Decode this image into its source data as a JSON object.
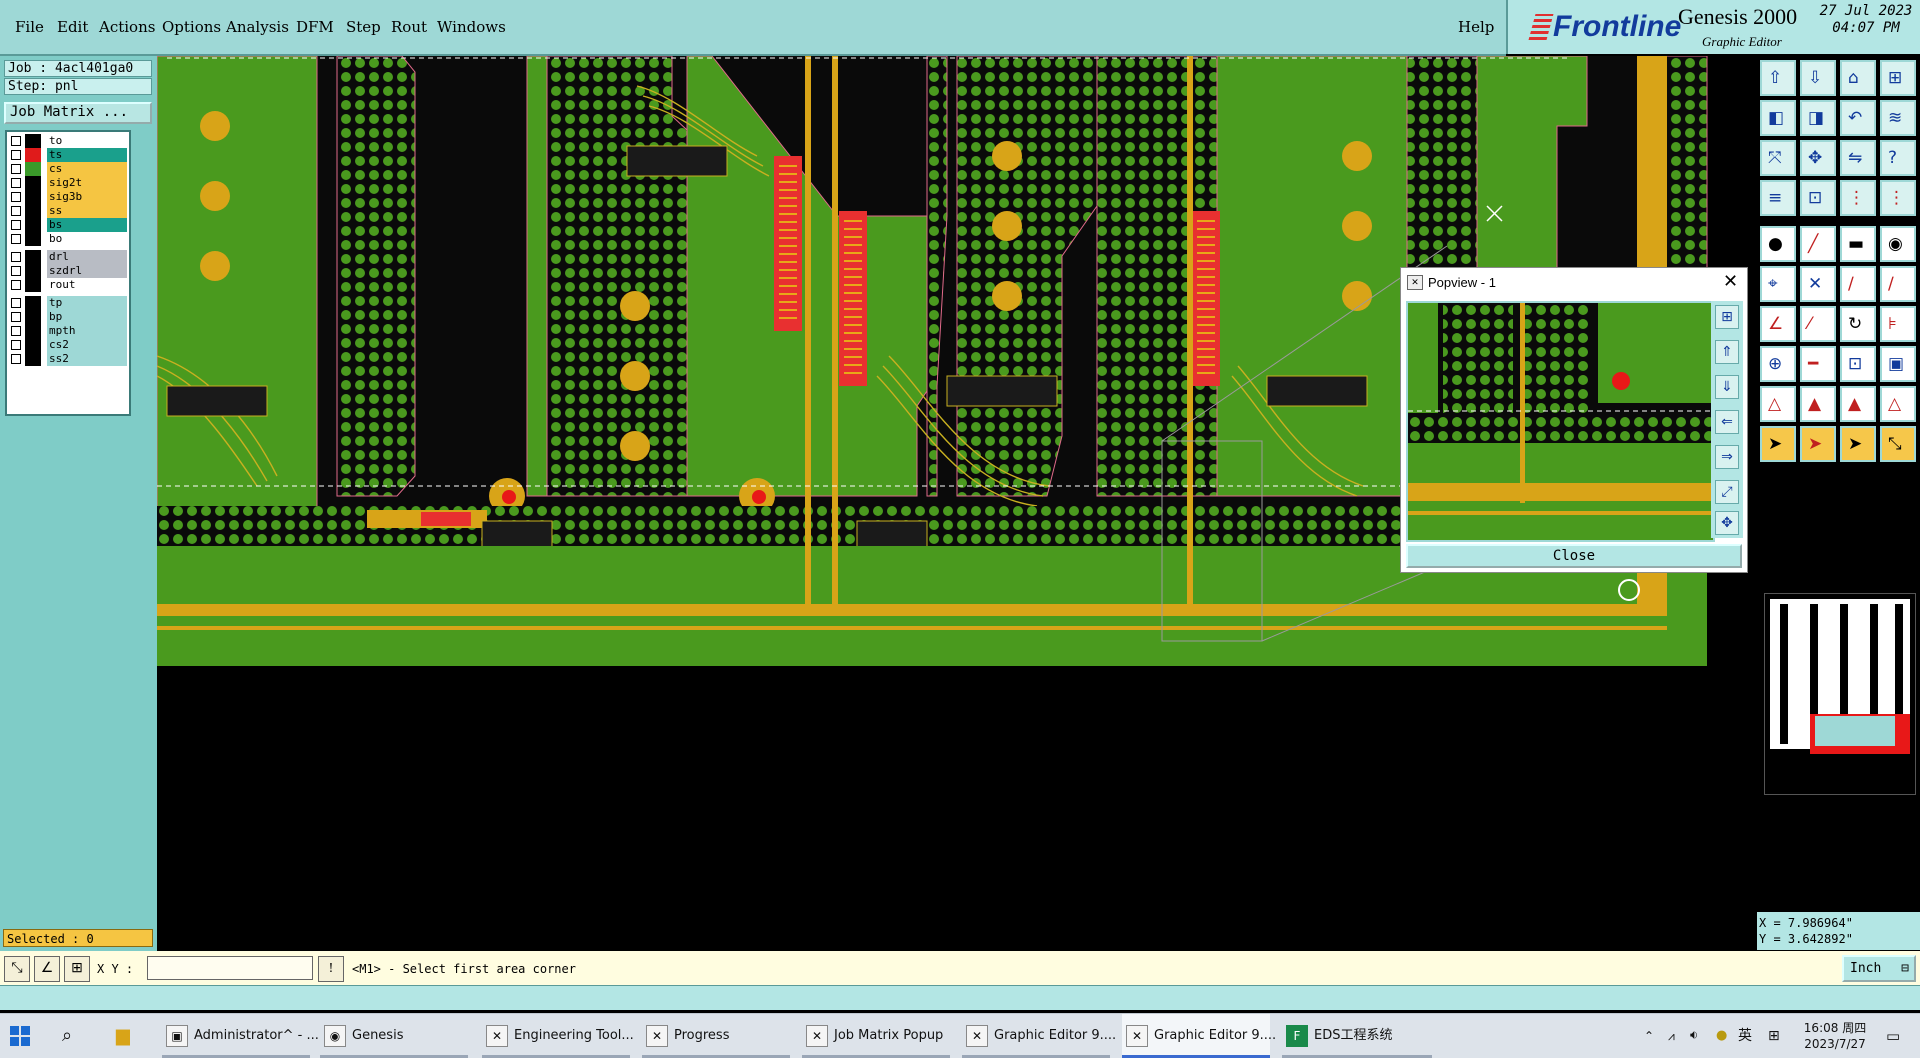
{
  "menubar": {
    "items": [
      "File",
      "Edit",
      "Actions",
      "Options",
      "Analysis",
      "DFM",
      "Step",
      "Rout",
      "Windows"
    ],
    "help": "Help"
  },
  "brand": {
    "logo": "Frontline",
    "product": "Genesis 2000",
    "subtitle": "Graphic Editor",
    "date": "27 Jul 2023",
    "time": "04:07 PM"
  },
  "job": {
    "job_line": "Job : 4acl401ga0",
    "step_line": "Step: pnl",
    "matrix_button": "Job Matrix ..."
  },
  "layers": [
    {
      "name": "to",
      "color": "#000000",
      "bg": "#ffffff"
    },
    {
      "name": "ts",
      "color": "#e01b1b",
      "bg": "#1aa08c",
      "active": true
    },
    {
      "name": "cs",
      "color": "#3a9a2a",
      "bg": "#f5c542"
    },
    {
      "name": "sig2t",
      "color": "#000000",
      "bg": "#f5c542"
    },
    {
      "name": "sig3b",
      "color": "#000000",
      "bg": "#f5c542"
    },
    {
      "name": "ss",
      "color": "#000000",
      "bg": "#f5c542"
    },
    {
      "name": "bs",
      "color": "#000000",
      "bg": "#1aa08c"
    },
    {
      "name": "bo",
      "color": "#000000",
      "bg": "#ffffff"
    },
    {
      "name": "drl",
      "color": "#000000",
      "bg": "#b8bcc4"
    },
    {
      "name": "szdrl",
      "color": "#000000",
      "bg": "#b8bcc4"
    },
    {
      "name": "rout",
      "color": "#000000",
      "bg": "#ffffff"
    },
    {
      "name": "tp",
      "color": "#000000",
      "bg": "#9ed8d6"
    },
    {
      "name": "bp",
      "color": "#000000",
      "bg": "#9ed8d6"
    },
    {
      "name": "mpth",
      "color": "#000000",
      "bg": "#9ed8d6"
    },
    {
      "name": "cs2",
      "color": "#000000",
      "bg": "#9ed8d6"
    },
    {
      "name": "ss2",
      "color": "#000000",
      "bg": "#9ed8d6"
    }
  ],
  "selected": "Selected : 0",
  "popview": {
    "title": "Popview - 1",
    "close_label": "Close"
  },
  "coords": {
    "x": "X = 7.986964\"",
    "y": "Y = 3.642892\""
  },
  "command": {
    "xy_label": "X Y :",
    "xy_value": "",
    "prompt": "<M1> - Select first area corner",
    "units": "Inch"
  },
  "taskbar": {
    "items": [
      {
        "label": "Administrator^ - ...",
        "icon": "disk-icon"
      },
      {
        "label": "Genesis",
        "icon": "genesis-icon"
      },
      {
        "label": "Engineering Tool...",
        "icon": "window-icon"
      },
      {
        "label": "Progress",
        "icon": "window-icon"
      },
      {
        "label": "Job Matrix Popup",
        "icon": "window-icon"
      },
      {
        "label": "Graphic Editor 9....",
        "icon": "window-icon"
      },
      {
        "label": "Graphic Editor 9....",
        "icon": "window-icon"
      },
      {
        "label": "EDS工程系统",
        "icon": "eds-icon"
      }
    ],
    "ime": "英",
    "clock_time": "16:08 周四",
    "clock_date": "2023/7/27"
  }
}
